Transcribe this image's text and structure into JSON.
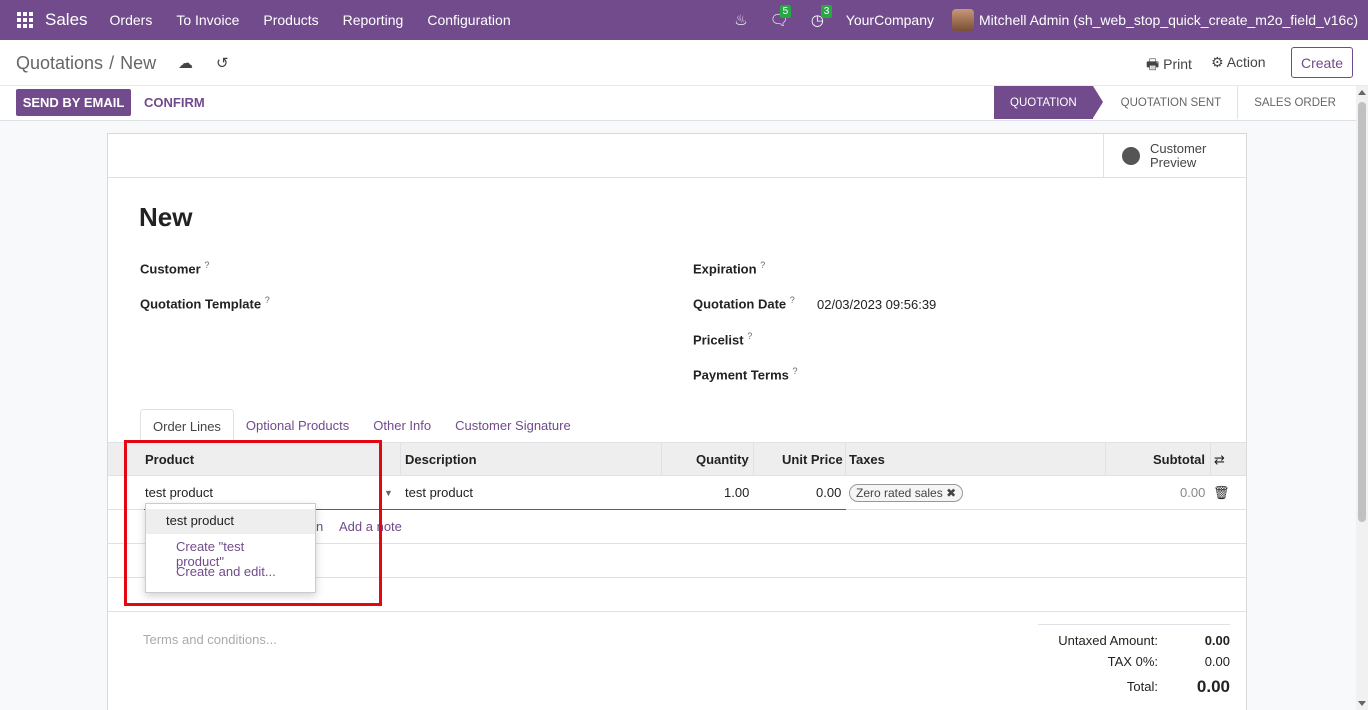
{
  "navbar": {
    "brand": "Sales",
    "menu": [
      "Orders",
      "To Invoice",
      "Products",
      "Reporting",
      "Configuration"
    ],
    "chat_count": "5",
    "activity_count": "3",
    "company": "YourCompany",
    "user": "Mitchell Admin (sh_web_stop_quick_create_m2o_field_v16c)"
  },
  "control_panel": {
    "breadcrumb_parent": "Quotations",
    "breadcrumb_sep": "/",
    "breadcrumb_current": "New",
    "print_label": "Print",
    "action_label": "Action",
    "create_label": "Create",
    "send_label": "SEND BY EMAIL",
    "confirm_label": "CONFIRM",
    "stages": [
      "QUOTATION",
      "QUOTATION SENT",
      "SALES ORDER"
    ]
  },
  "form": {
    "preview_label_1": "Customer",
    "preview_label_2": "Preview",
    "title": "New",
    "customer_label": "Customer",
    "template_label": "Quotation Template",
    "expiration_label": "Expiration",
    "quotation_date_label": "Quotation Date",
    "quotation_date_value": "02/03/2023 09:56:39",
    "pricelist_label": "Pricelist",
    "payment_terms_label": "Payment Terms",
    "help_mark": "?"
  },
  "tabs": [
    "Order Lines",
    "Optional Products",
    "Other Info",
    "Customer Signature"
  ],
  "order_lines": {
    "headers": {
      "product": "Product",
      "description": "Description",
      "quantity": "Quantity",
      "unit_price": "Unit Price",
      "taxes": "Taxes",
      "subtotal": "Subtotal"
    },
    "row": {
      "product": "test product",
      "description": "test product",
      "quantity": "1.00",
      "unit_price": "0.00",
      "tax": "Zero rated sales",
      "subtotal": "0.00"
    },
    "add_section_fragment": "n",
    "add_note": "Add a note"
  },
  "dropdown": {
    "items": [
      "test product",
      "Create \"test product\"",
      "Create and edit..."
    ]
  },
  "footer": {
    "terms_placeholder": "Terms and conditions...",
    "untaxed_label": "Untaxed Amount:",
    "untaxed_value": "0.00",
    "tax_label": "TAX 0%:",
    "tax_value": "0.00",
    "total_label": "Total:",
    "total_value": "0.00"
  },
  "colors": {
    "primary": "#714b8c",
    "highlight": "#e40613",
    "badge": "#28a745"
  }
}
